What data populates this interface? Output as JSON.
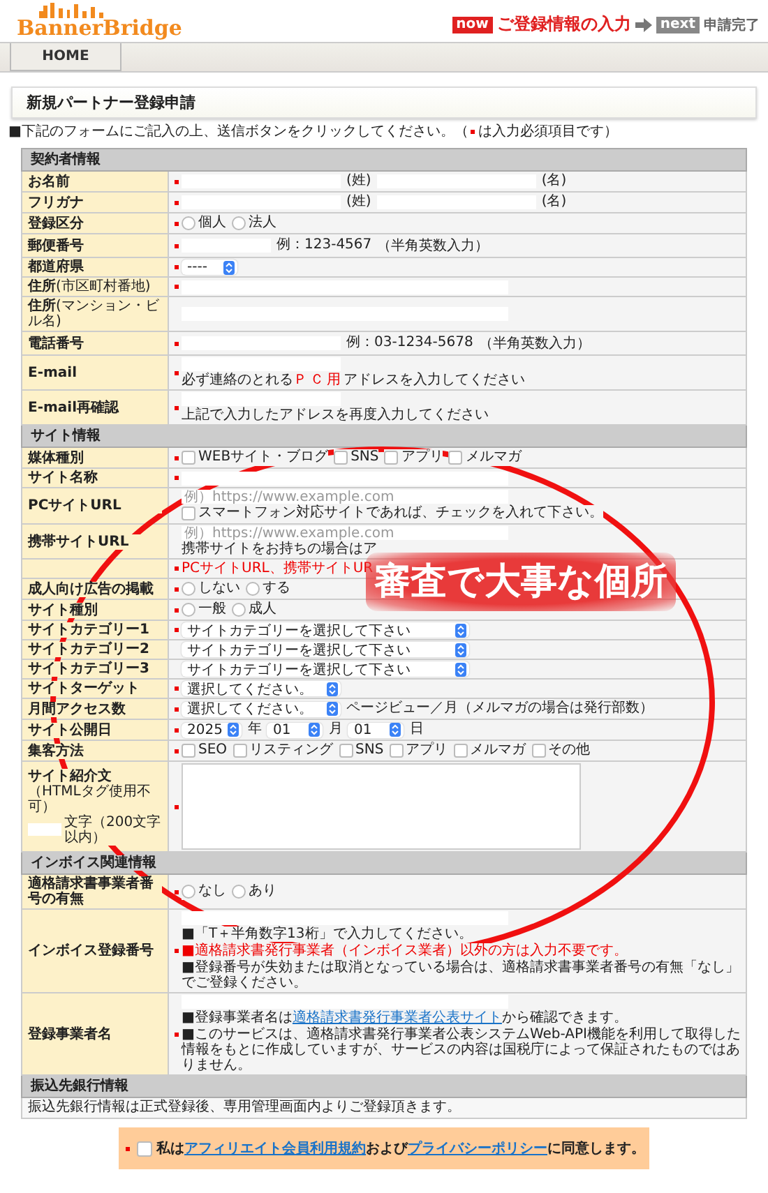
{
  "header": {
    "logo": "BannerBridge",
    "steps": [
      {
        "badge": "now",
        "label": "ご登録情報の入力",
        "current": true
      },
      {
        "badge": "next",
        "label": "申請完了",
        "current": false
      }
    ]
  },
  "nav": [
    {
      "label": "HOME"
    }
  ],
  "page_title": "新規パートナー登録申請",
  "instruction": {
    "before": "■下記のフォームにご記入の上、送信ボタンをクリックしてください。（",
    "after": "は入力必須項目です）"
  },
  "sections": [
    {
      "title": "契約者情報",
      "rows": [
        {
          "label": "お名前",
          "required": true,
          "lines": [
            [
              {
                "kind": "input"
              },
              {
                "kind": "text",
                "text": "(姓)"
              },
              {
                "kind": "input"
              },
              {
                "kind": "text",
                "text": "(名)"
              }
            ]
          ]
        },
        {
          "label": "フリガナ",
          "required": true,
          "lines": [
            [
              {
                "kind": "input"
              },
              {
                "kind": "text",
                "text": "(姓)"
              },
              {
                "kind": "input"
              },
              {
                "kind": "text",
                "text": "(名)"
              }
            ]
          ]
        },
        {
          "label": "登録区分",
          "required": true,
          "lines": [
            [
              {
                "kind": "radio",
                "label": "個人",
                "selected": false
              },
              {
                "kind": "radio",
                "label": "法人",
                "selected": false
              }
            ]
          ]
        },
        {
          "label": "郵便番号",
          "required": true,
          "lines": [
            [
              {
                "kind": "input_short"
              },
              {
                "kind": "text",
                "text": "例：123-4567"
              },
              {
                "kind": "small",
                "text": "（半角英数入力）"
              }
            ]
          ]
        },
        {
          "label": "都道府県",
          "required": true,
          "lines": [
            [
              {
                "kind": "select_short",
                "value": "----"
              }
            ]
          ]
        },
        {
          "label": "住所",
          "label_note": "(市区町村番地)",
          "required": true,
          "lines": [
            [
              {
                "kind": "input_long"
              }
            ]
          ]
        },
        {
          "label": "住所",
          "label_note": "(マンション・ビル名)",
          "required": false,
          "lines": [
            [
              {
                "kind": "input_long"
              }
            ]
          ]
        },
        {
          "label": "電話番号",
          "required": true,
          "lines": [
            [
              {
                "kind": "input"
              },
              {
                "kind": "text",
                "text": "例：03-1234-5678"
              },
              {
                "kind": "small",
                "text": "（半角英数入力）"
              }
            ]
          ]
        },
        {
          "label": "E-mail",
          "required": true,
          "lines": [
            [
              {
                "kind": "input"
              }
            ],
            [
              {
                "kind": "note",
                "parts": [
                  {
                    "kind": "plain",
                    "text": "必ず連絡のとれる"
                  },
                  {
                    "kind": "emphasis",
                    "text": "ＰＣ用"
                  },
                  {
                    "kind": "plain",
                    "text": "アドレスを入力してください"
                  }
                ]
              }
            ]
          ]
        },
        {
          "label": "E-mail再確認",
          "required": true,
          "lines": [
            [
              {
                "kind": "input"
              }
            ],
            [
              {
                "kind": "note",
                "text": "上記で入力したアドレスを再度入力してください"
              }
            ]
          ]
        }
      ]
    },
    {
      "title": "サイト情報",
      "rows": [
        {
          "label": "媒体種別",
          "required": true,
          "lines": [
            [
              {
                "kind": "checkbox",
                "label": "WEBサイト・ブログ",
                "checked": false
              },
              {
                "kind": "checkbox",
                "label": "SNS",
                "checked": false
              },
              {
                "kind": "checkbox",
                "label": "アプリ",
                "checked": false
              },
              {
                "kind": "checkbox",
                "label": "メルマガ",
                "checked": false
              }
            ]
          ]
        },
        {
          "label": "サイト名称",
          "required": true,
          "lines": [
            [
              {
                "kind": "input_long"
              }
            ]
          ]
        },
        {
          "label": "PCサイトURL",
          "required": false,
          "lines": [
            [
              {
                "kind": "input_long",
                "placeholder": "例）https://www.example.com"
              }
            ],
            [
              {
                "kind": "checkbox",
                "label": "スマートフォン対応サイトであれば、チェックを入れて下さい。",
                "checked": false
              }
            ]
          ]
        },
        {
          "label": "携帯サイトURL",
          "required": false,
          "lines": [
            [
              {
                "kind": "input_long",
                "placeholder": "例）https://www.example.com"
              }
            ],
            [
              {
                "kind": "note",
                "text": "携帯サイトをお持ちの場合はア"
              }
            ]
          ]
        },
        {
          "required": true,
          "lines": [
            [
              {
                "kind": "warning",
                "text": "PCサイトURL、携帯サイトUR"
              }
            ]
          ]
        },
        {
          "label": "成人向け広告の掲載",
          "required": true,
          "lines": [
            [
              {
                "kind": "radio",
                "label": "しない",
                "selected": false
              },
              {
                "kind": "radio",
                "label": "する",
                "selected": false
              }
            ]
          ]
        },
        {
          "label": "サイト種別",
          "required": true,
          "lines": [
            [
              {
                "kind": "radio",
                "label": "一般",
                "selected": false
              },
              {
                "kind": "radio",
                "label": "成人",
                "selected": false
              }
            ]
          ]
        },
        {
          "label": "サイトカテゴリー1",
          "required": true,
          "lines": [
            [
              {
                "kind": "select_long",
                "value": "サイトカテゴリーを選択して下さい"
              }
            ]
          ]
        },
        {
          "label": "サイトカテゴリー2",
          "required": false,
          "lines": [
            [
              {
                "kind": "select_long",
                "value": "サイトカテゴリーを選択して下さい"
              }
            ]
          ]
        },
        {
          "label": "サイトカテゴリー3",
          "required": false,
          "lines": [
            [
              {
                "kind": "select_long",
                "value": "サイトカテゴリーを選択して下さい"
              }
            ]
          ]
        },
        {
          "label": "サイトターゲット",
          "required": true,
          "lines": [
            [
              {
                "kind": "select",
                "value": "選択してください。"
              }
            ]
          ]
        },
        {
          "label": "月間アクセス数",
          "required": true,
          "lines": [
            [
              {
                "kind": "select",
                "value": "選択してください。"
              },
              {
                "kind": "text",
                "text": "ページビュー／月（メルマガの場合は発行部数）"
              }
            ]
          ]
        },
        {
          "label": "サイト公開日",
          "required": true,
          "lines": [
            [
              {
                "kind": "select_short",
                "value": "2025"
              },
              {
                "kind": "text",
                "text": "年"
              },
              {
                "kind": "select_short",
                "value": "01"
              },
              {
                "kind": "text",
                "text": "月"
              },
              {
                "kind": "select_short",
                "value": "01"
              },
              {
                "kind": "text",
                "text": "日"
              }
            ]
          ]
        },
        {
          "label": "集客方法",
          "required": true,
          "lines": [
            [
              {
                "kind": "checkbox",
                "label": "SEO",
                "checked": false
              },
              {
                "kind": "checkbox",
                "label": "リスティング",
                "checked": false
              },
              {
                "kind": "checkbox",
                "label": "SNS",
                "checked": false
              },
              {
                "kind": "checkbox",
                "label": "アプリ",
                "checked": false
              },
              {
                "kind": "checkbox",
                "label": "メルマガ",
                "checked": false
              },
              {
                "kind": "checkbox",
                "label": "その他",
                "checked": false
              }
            ]
          ]
        },
        {
          "label": "サイト紹介文",
          "label_note": "（HTMLタグ使用不可）",
          "label_counter": "文字（200文字以内）",
          "required": true,
          "lines": [
            [
              {
                "kind": "textarea"
              }
            ]
          ]
        }
      ]
    },
    {
      "title": "インボイス関連情報",
      "rows": [
        {
          "label": "適格請求書事業者番号の有無",
          "required": true,
          "lines": [
            [
              {
                "kind": "radio",
                "label": "なし",
                "selected": false
              },
              {
                "kind": "radio",
                "label": "あり",
                "selected": false
              }
            ]
          ]
        },
        {
          "label": "インボイス登録番号",
          "required": true,
          "lines": [
            [
              {
                "kind": "input_long"
              }
            ],
            [
              {
                "kind": "note",
                "text": "■「T＋半角数字13桁」で入力してください。"
              }
            ],
            [
              {
                "kind": "warning",
                "text": "■適格請求書発行事業者（インボイス業者）以外の方は入力不要です。"
              }
            ],
            [
              {
                "kind": "note",
                "text": "■登録番号が失効または取消となっている場合は、適格請求書事業者番号の有無「なし」でご登録ください。"
              }
            ]
          ]
        },
        {
          "label": "登録事業者名",
          "required": true,
          "lines": [
            [
              {
                "kind": "input_long"
              }
            ],
            [
              {
                "kind": "note",
                "parts": [
                  {
                    "kind": "plain",
                    "text": "■登録事業者名は"
                  },
                  {
                    "kind": "link",
                    "text": "適格請求書発行事業者公表サイト"
                  },
                  {
                    "kind": "plain",
                    "text": "から確認できます。"
                  }
                ]
              }
            ],
            [
              {
                "kind": "note",
                "text": "■このサービスは、適格請求書発行事業者公表システムWeb-API機能を利用して取得した情報をもとに作成していますが、サービスの内容は国税庁によって保証されたものではありません。"
              }
            ]
          ]
        }
      ]
    },
    {
      "title": "振込先銀行情報",
      "text": "振込先銀行情報は正式登録後、専用管理画面内よりご登録頂きます。"
    }
  ],
  "agreement": {
    "required": true,
    "checked": false,
    "parts": [
      {
        "kind": "plain",
        "text": "私は"
      },
      {
        "kind": "link",
        "text": "アフィリエイト会員利用規約"
      },
      {
        "kind": "plain",
        "text": "および"
      },
      {
        "kind": "link",
        "text": "プライバシーポリシー"
      },
      {
        "kind": "plain",
        "text": "に同意します。"
      }
    ]
  },
  "annotation": {
    "text": "審査で大事な個所"
  }
}
